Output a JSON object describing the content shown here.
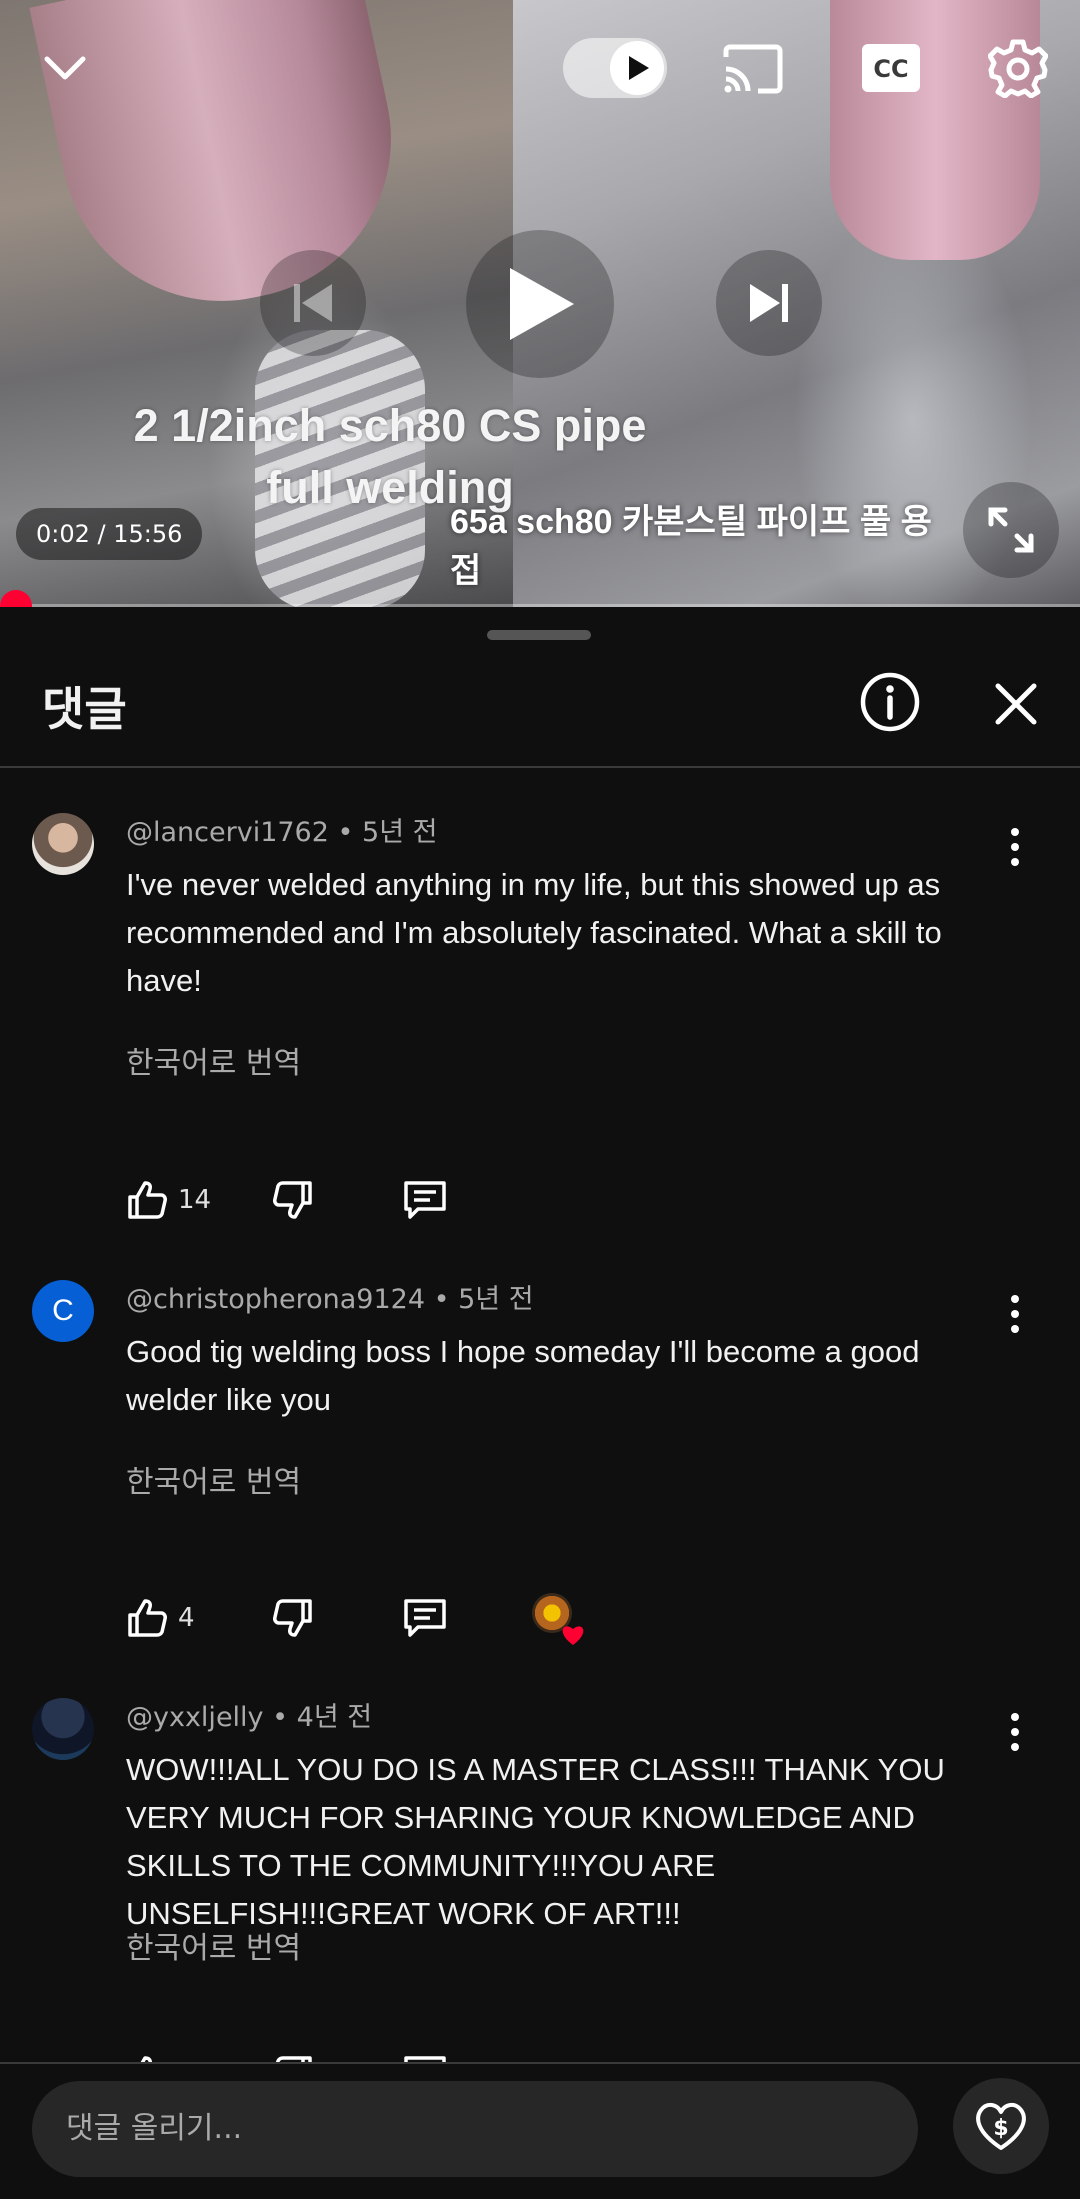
{
  "video": {
    "overlay_title": "2 1/2inch sch80 CS pipe full welding",
    "overlay_subtitle": "65a sch80 카본스틸 파이프 풀 용접",
    "time": "0:02 / 15:56",
    "progress": 0.002,
    "autoplay_on": true,
    "icons": [
      "chevron-down-icon",
      "autoplay-toggle",
      "cast-icon",
      "cc-icon",
      "gear-icon",
      "previous-icon",
      "play-icon",
      "next-icon",
      "fullscreen-icon"
    ]
  },
  "comments_panel": {
    "title": "댓글",
    "comments": [
      {
        "author": "@lancervi1762",
        "age": "5년 전",
        "text": "I've never welded anything in my life, but this showed up as recommended and I'm absolutely fascinated. What a skill to have!",
        "translate": "한국어로 번역",
        "likes": "14"
      },
      {
        "author": "@christopherona9124",
        "age": "5년 전",
        "avatar_letter": "C",
        "text": "Good tig welding boss I hope someday I'll become a good welder like you",
        "translate": "한국어로 번역",
        "likes": "4",
        "creator_hearted": true
      },
      {
        "author": "@yxxljelly",
        "age": "4년 전",
        "text": "WOW!!!ALL YOU DO IS A MASTER CLASS!!! THANK YOU VERY MUCH FOR SHARING YOUR KNOWLEDGE AND SKILLS TO THE COMMUNITY!!!YOU ARE UNSELFISH!!!GREAT WORK OF ART!!!",
        "translate": "한국어로 번역"
      }
    ]
  },
  "reply_bar": {
    "placeholder": "댓글 올리기..."
  },
  "colors": {
    "background": "#0f0f0f",
    "accent_red": "#ff0033",
    "muted_text": "#aaaaaa",
    "input_bg": "#272727"
  }
}
